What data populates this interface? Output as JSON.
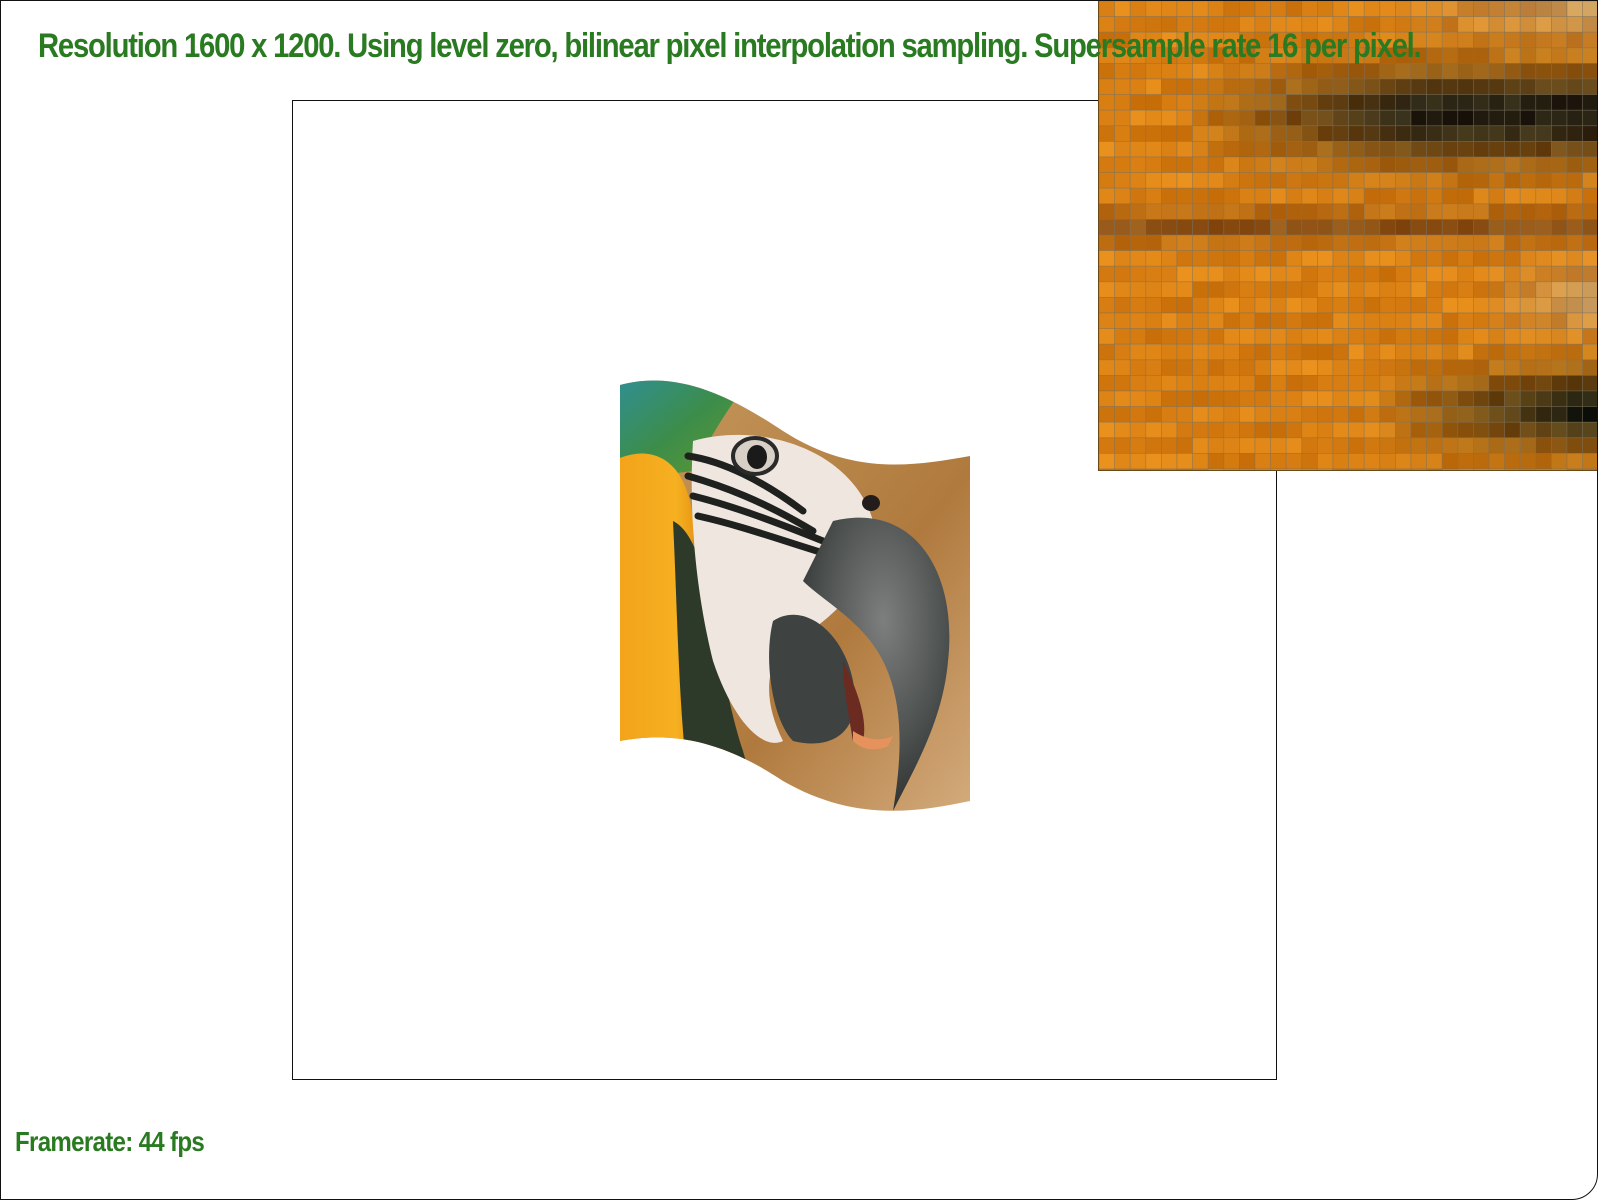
{
  "status": {
    "resolution_label": "Resolution 1600 x 1200. Using level zero, bilinear pixel interpolation sampling. Supersample rate 16 per pixel."
  },
  "footer": {
    "framerate_label": "Framerate: 44 fps"
  },
  "colors": {
    "status_text": "#2a7a22",
    "background": "#ffffff",
    "frame_border": "#111111"
  },
  "canvas": {
    "content": "textured-wavy-parrot-flag"
  },
  "zoom_panel": {
    "content": "magnified-pixel-grid"
  }
}
